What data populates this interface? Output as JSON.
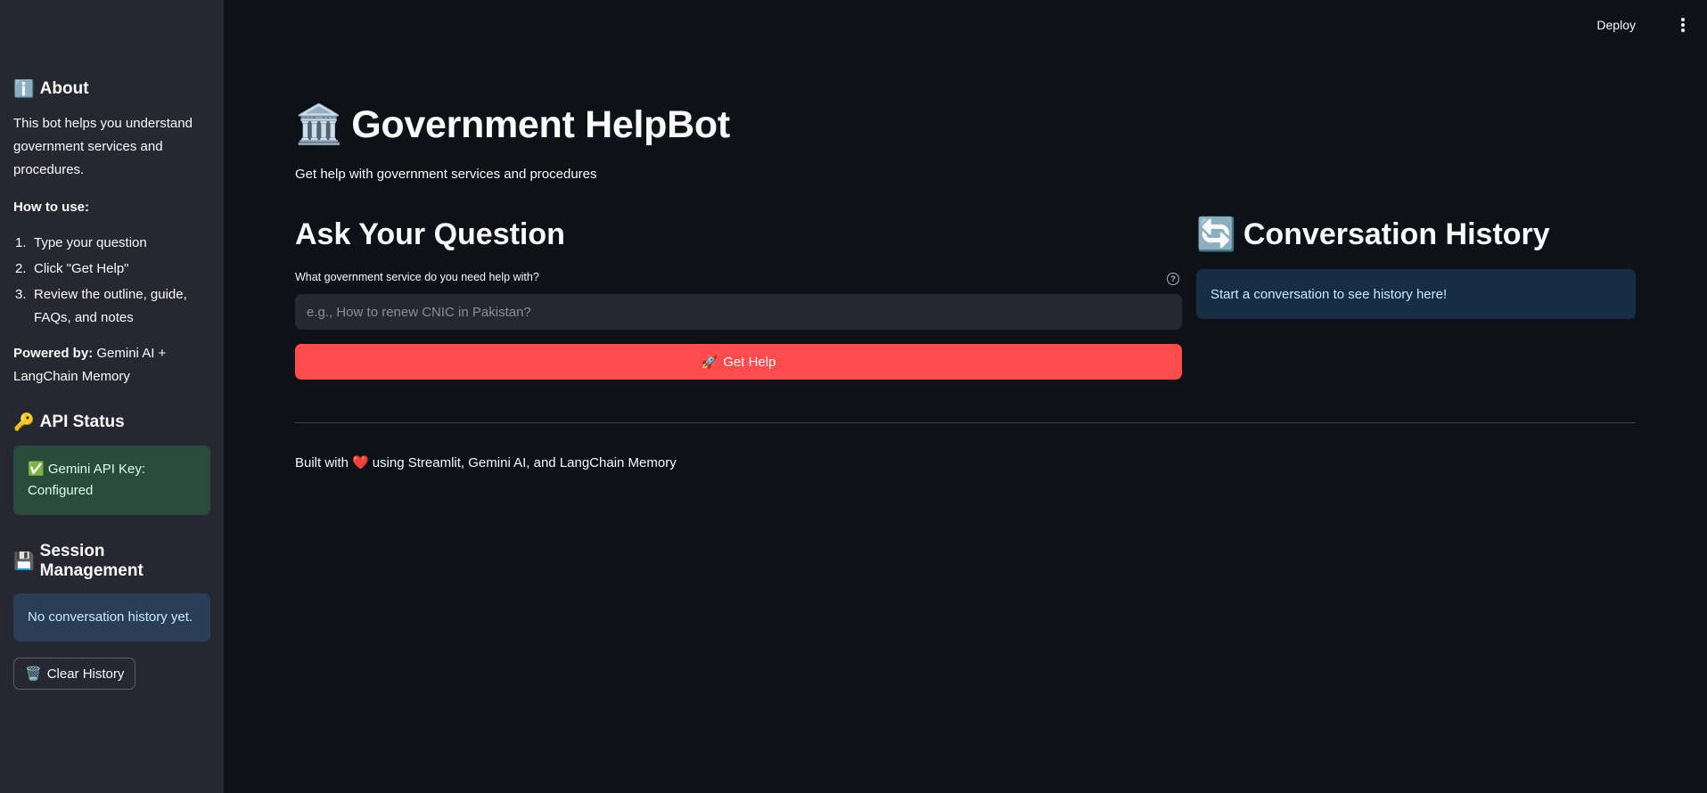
{
  "header": {
    "deploy_label": "Deploy"
  },
  "sidebar": {
    "about": {
      "icon": "ℹ️",
      "heading": "About",
      "description": "This bot helps you understand government services and procedures.",
      "how_to_use_label": "How to use:",
      "steps": [
        {
          "num": "1.",
          "text": "Type your question"
        },
        {
          "num": "2.",
          "text": "Click \"Get Help\""
        },
        {
          "num": "3.",
          "text": "Review the outline, guide, FAQs, and notes"
        }
      ],
      "powered_by_label": "Powered by:",
      "powered_by_value": " Gemini AI + LangChain Memory"
    },
    "api_status": {
      "icon": "🔑",
      "heading": "API Status",
      "message": "✅ Gemini API Key: Configured"
    },
    "session": {
      "icon": "💾",
      "heading": "Session Management",
      "message": "No conversation history yet.",
      "clear_icon": "🗑️",
      "clear_label": "Clear History"
    }
  },
  "main": {
    "title_icon": "🏛️",
    "title": "Government HelpBot",
    "subtitle": "Get help with government services and procedures",
    "ask_heading": "Ask Your Question",
    "question_label": "What government service do you need help with?",
    "question_help": "?",
    "question_placeholder": "e.g., How to renew CNIC in Pakistan?",
    "question_value": "",
    "submit_icon": "🚀",
    "submit_label": "Get Help",
    "history_icon": "🔄",
    "history_heading": "Conversation History",
    "history_empty": "Start a conversation to see history here!",
    "footer_prefix": "Built with",
    "footer_heart": "❤️",
    "footer_suffix": "using Streamlit, Gemini AI, and LangChain Memory"
  },
  "colors": {
    "background": "#0e1117",
    "sidebar": "#262730",
    "primary": "#ff4b4b",
    "success_bg": "#2b4a36",
    "info_bg": "#172d43"
  },
  "icons": {
    "menu": "kebab-menu-icon",
    "help": "question-circle-icon"
  }
}
